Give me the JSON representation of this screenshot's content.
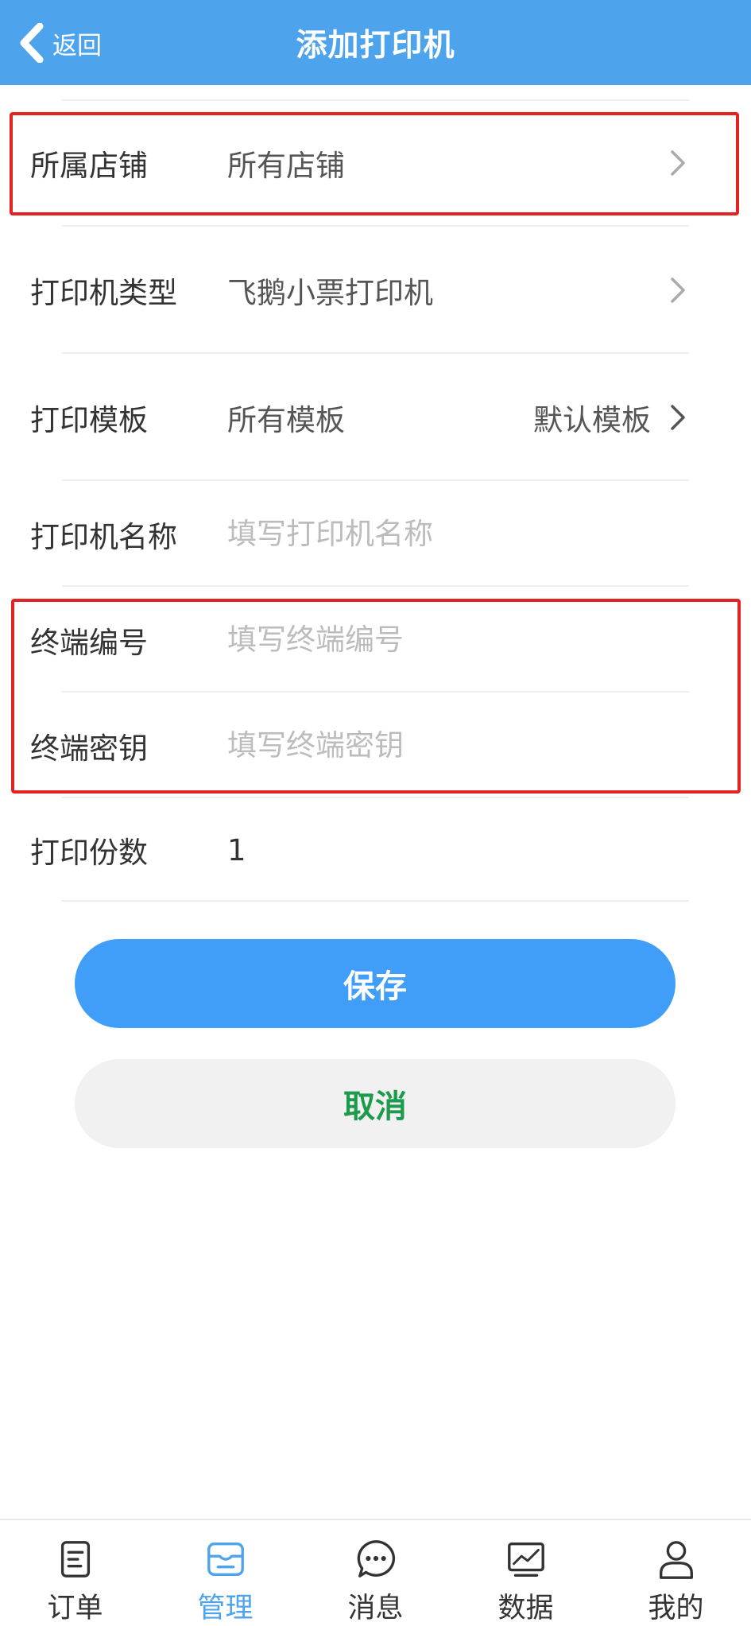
{
  "header": {
    "back_label": "返回",
    "title": "添加打印机",
    "bg_color": "#4ea4ec"
  },
  "form": {
    "store": {
      "label": "所属店铺",
      "value": "所有店铺"
    },
    "printer_type": {
      "label": "打印机类型",
      "value": "飞鹅小票打印机"
    },
    "template": {
      "label": "打印模板",
      "value": "所有模板",
      "selected": "默认模板"
    },
    "printer_name": {
      "label": "打印机名称",
      "placeholder": "填写打印机名称"
    },
    "terminal_no": {
      "label": "终端编号",
      "placeholder": "填写终端编号"
    },
    "terminal_key": {
      "label": "终端密钥",
      "placeholder": "填写终端密钥"
    },
    "copies": {
      "label": "打印份数",
      "value": "1"
    }
  },
  "buttons": {
    "save": "保存",
    "cancel": "取消"
  },
  "tabbar": {
    "items": [
      {
        "label": "订单",
        "icon": "order-icon"
      },
      {
        "label": "管理",
        "icon": "manage-icon",
        "active": true
      },
      {
        "label": "消息",
        "icon": "message-icon"
      },
      {
        "label": "数据",
        "icon": "data-chart-icon"
      },
      {
        "label": "我的",
        "icon": "profile-icon"
      }
    ]
  },
  "colors": {
    "accent": "#409ef8",
    "cancel_text": "#1d9b4c",
    "highlight": "#e32222"
  }
}
